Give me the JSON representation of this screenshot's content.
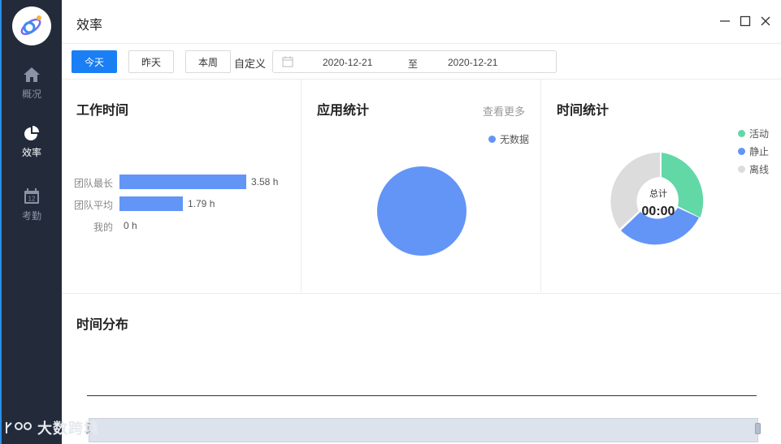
{
  "sidebar": {
    "items": [
      {
        "label": "概况",
        "icon": "home-icon"
      },
      {
        "label": "效率",
        "icon": "pie-chart-icon"
      },
      {
        "label": "考勤",
        "icon": "calendar-icon"
      }
    ]
  },
  "header": {
    "title": "效率"
  },
  "toolbar": {
    "today": "今天",
    "yesterday": "昨天",
    "this_week": "本周",
    "custom": "自定义",
    "date_from": "2020-12-21",
    "date_separator": "至",
    "date_to": "2020-12-21"
  },
  "work_time": {
    "title": "工作时间",
    "rows": [
      {
        "label": "团队最长",
        "value": "3.58 h",
        "hours": 3.58
      },
      {
        "label": "团队平均",
        "value": "1.79 h",
        "hours": 1.79
      },
      {
        "label": "我的",
        "value": "0 h",
        "hours": 0
      }
    ]
  },
  "app_stats": {
    "title": "应用统计",
    "more": "查看更多",
    "legend": "无数据"
  },
  "time_stats": {
    "title": "时间统计",
    "legend": [
      "活动",
      "静止",
      "离线"
    ],
    "center_label": "总计",
    "center_value": "00:00"
  },
  "time_distribution": {
    "title": "时间分布"
  },
  "watermark": "大数跨境",
  "colors": {
    "primary": "#1a7ef4",
    "bar": "#6395f7",
    "active": "#63d8a7",
    "idle": "#6395f7",
    "offline": "#dcdcdc",
    "sidebar": "#232b3b"
  }
}
